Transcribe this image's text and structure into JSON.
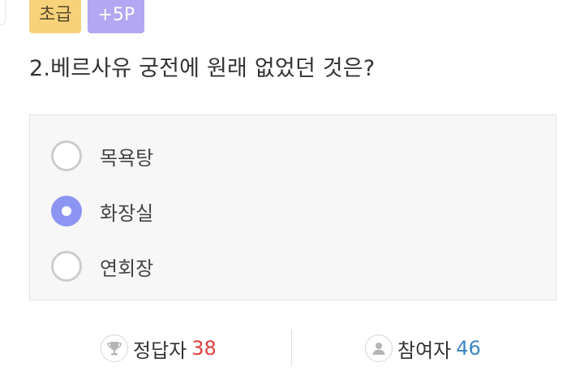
{
  "badges": {
    "level": "초급",
    "points": "+5P"
  },
  "question": {
    "text": "2.베르사유 궁전에 원래 없었던 것은?"
  },
  "options": [
    {
      "label": "목욕탕",
      "selected": false
    },
    {
      "label": "화장실",
      "selected": true
    },
    {
      "label": "연회장",
      "selected": false
    }
  ],
  "stats": {
    "correct": {
      "label": "정답자",
      "count": "38",
      "icon": "trophy-icon"
    },
    "participants": {
      "label": "참여자",
      "count": "46",
      "icon": "person-icon"
    }
  },
  "colors": {
    "level_badge": "#f7d27a",
    "points_badge": "#b3a6f2",
    "radio_selected": "#8c95f2",
    "correct_count": "#e0403f",
    "participant_count": "#3b86c7"
  }
}
